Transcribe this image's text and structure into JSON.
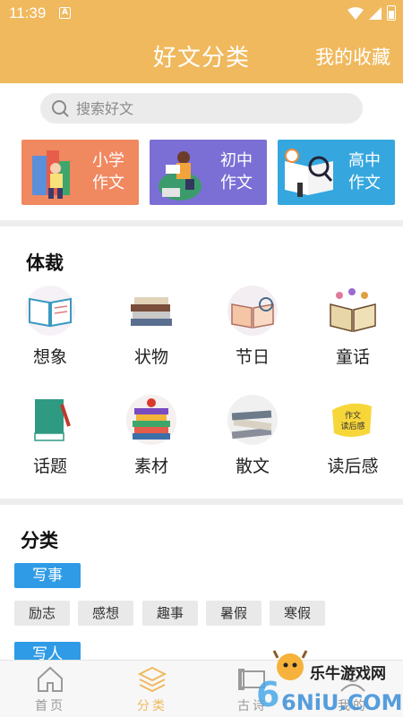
{
  "status_bar": {
    "time": "11:39",
    "notification_badge": "A"
  },
  "header": {
    "title": "好文分类",
    "favorites": "我的收藏"
  },
  "search": {
    "placeholder": "搜索好文"
  },
  "grade_cards": [
    {
      "line1": "小学",
      "line2": "作文",
      "color": "#f08860"
    },
    {
      "line1": "初中",
      "line2": "作文",
      "color": "#7b6fd6"
    },
    {
      "line1": "高中",
      "line2": "作文",
      "color": "#35a7de"
    }
  ],
  "genre_section": {
    "title": "体裁",
    "items": [
      "想象",
      "状物",
      "节日",
      "童话",
      "话题",
      "素材",
      "散文",
      "读后感"
    ],
    "icons": [
      "open-book-icon",
      "book-stack-icon",
      "open-book-magnifier-icon",
      "old-book-icon",
      "green-book-pen-icon",
      "book-stack-apple-icon",
      "book-pile-icon",
      "yellow-note-icon"
    ],
    "note_text": [
      "作文",
      "读后感"
    ]
  },
  "category_section": {
    "title": "分类",
    "groups": [
      {
        "tag": "写事",
        "chips": [
          "励志",
          "感想",
          "趣事",
          "暑假",
          "寒假"
        ]
      },
      {
        "tag": "写人",
        "chips": []
      }
    ]
  },
  "bottom_nav": {
    "items": [
      "首页",
      "分类",
      "古诗",
      "我的"
    ],
    "active_index": 1,
    "active_color": "#f0b95e",
    "inactive_color": "#9a9a9a"
  },
  "watermark": {
    "text": "乐牛游戏网",
    "logo_text": "6NiU.COM"
  }
}
